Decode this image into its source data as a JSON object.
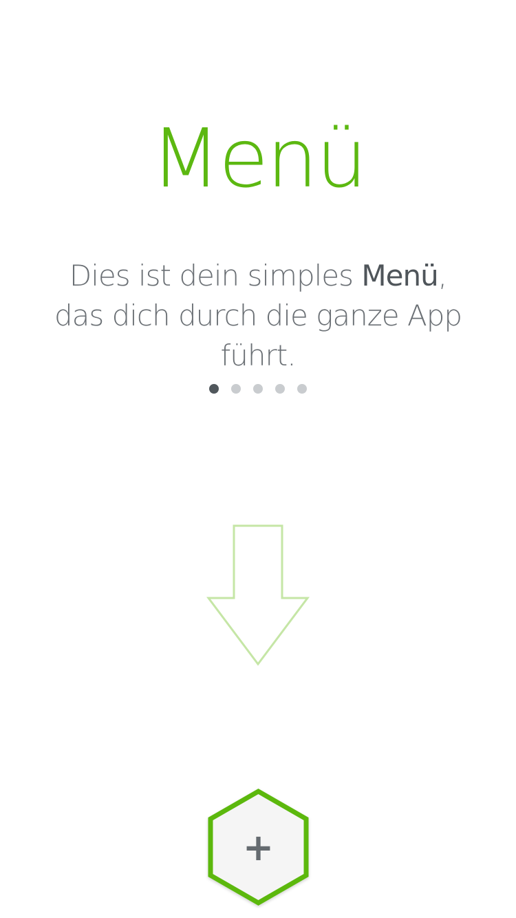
{
  "title": "Menü",
  "description": {
    "part1": "Dies ist dein simples ",
    "highlight": "Menü",
    "part2": ", das dich durch die ganze App führt."
  },
  "pager": {
    "total": 5,
    "active_index": 0
  },
  "add_button": {
    "label": "+"
  },
  "icons": {
    "arrow": "arrow-down-icon",
    "add": "plus-icon"
  },
  "colors": {
    "accent": "#5cb811",
    "arrow_stroke": "#c5e6a6",
    "text": "#6b7075",
    "text_strong": "#4f555a",
    "dot_active": "#50575c",
    "dot_inactive": "#c9cccf",
    "hex_fill": "#f5f5f5"
  }
}
